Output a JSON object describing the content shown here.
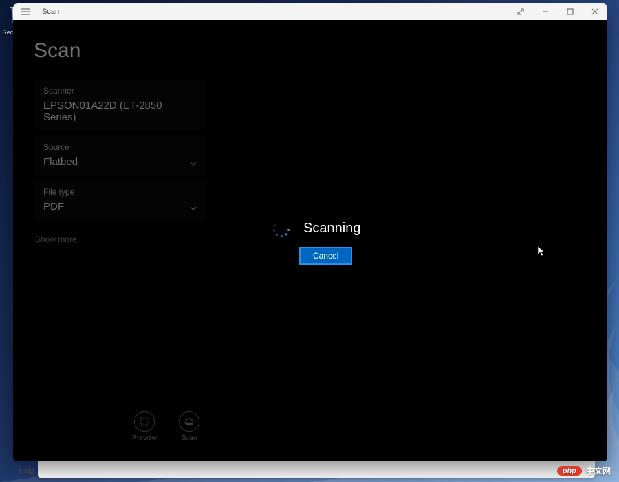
{
  "desktop": {
    "recycle_bin_label": "Recycle Bin"
  },
  "window": {
    "title": "Scan"
  },
  "page": {
    "title": "Scan"
  },
  "fields": {
    "scanner": {
      "label": "Scanner",
      "value": "EPSON01A22D (ET-2850 Series)"
    },
    "source": {
      "label": "Source",
      "value": "Flatbed"
    },
    "filetype": {
      "label": "File type",
      "value": "PDF"
    }
  },
  "links": {
    "show_more": "Show more"
  },
  "buttons": {
    "preview": "Preview",
    "scan": "Scan",
    "cancel": "Cancel"
  },
  "status": {
    "text": "Scanning"
  },
  "behind": {
    "help": "Help"
  },
  "watermark": {
    "pill": "php",
    "text": "中文网"
  },
  "colors": {
    "accent": "#0067c0",
    "accent_border": "#2a8fe8"
  }
}
